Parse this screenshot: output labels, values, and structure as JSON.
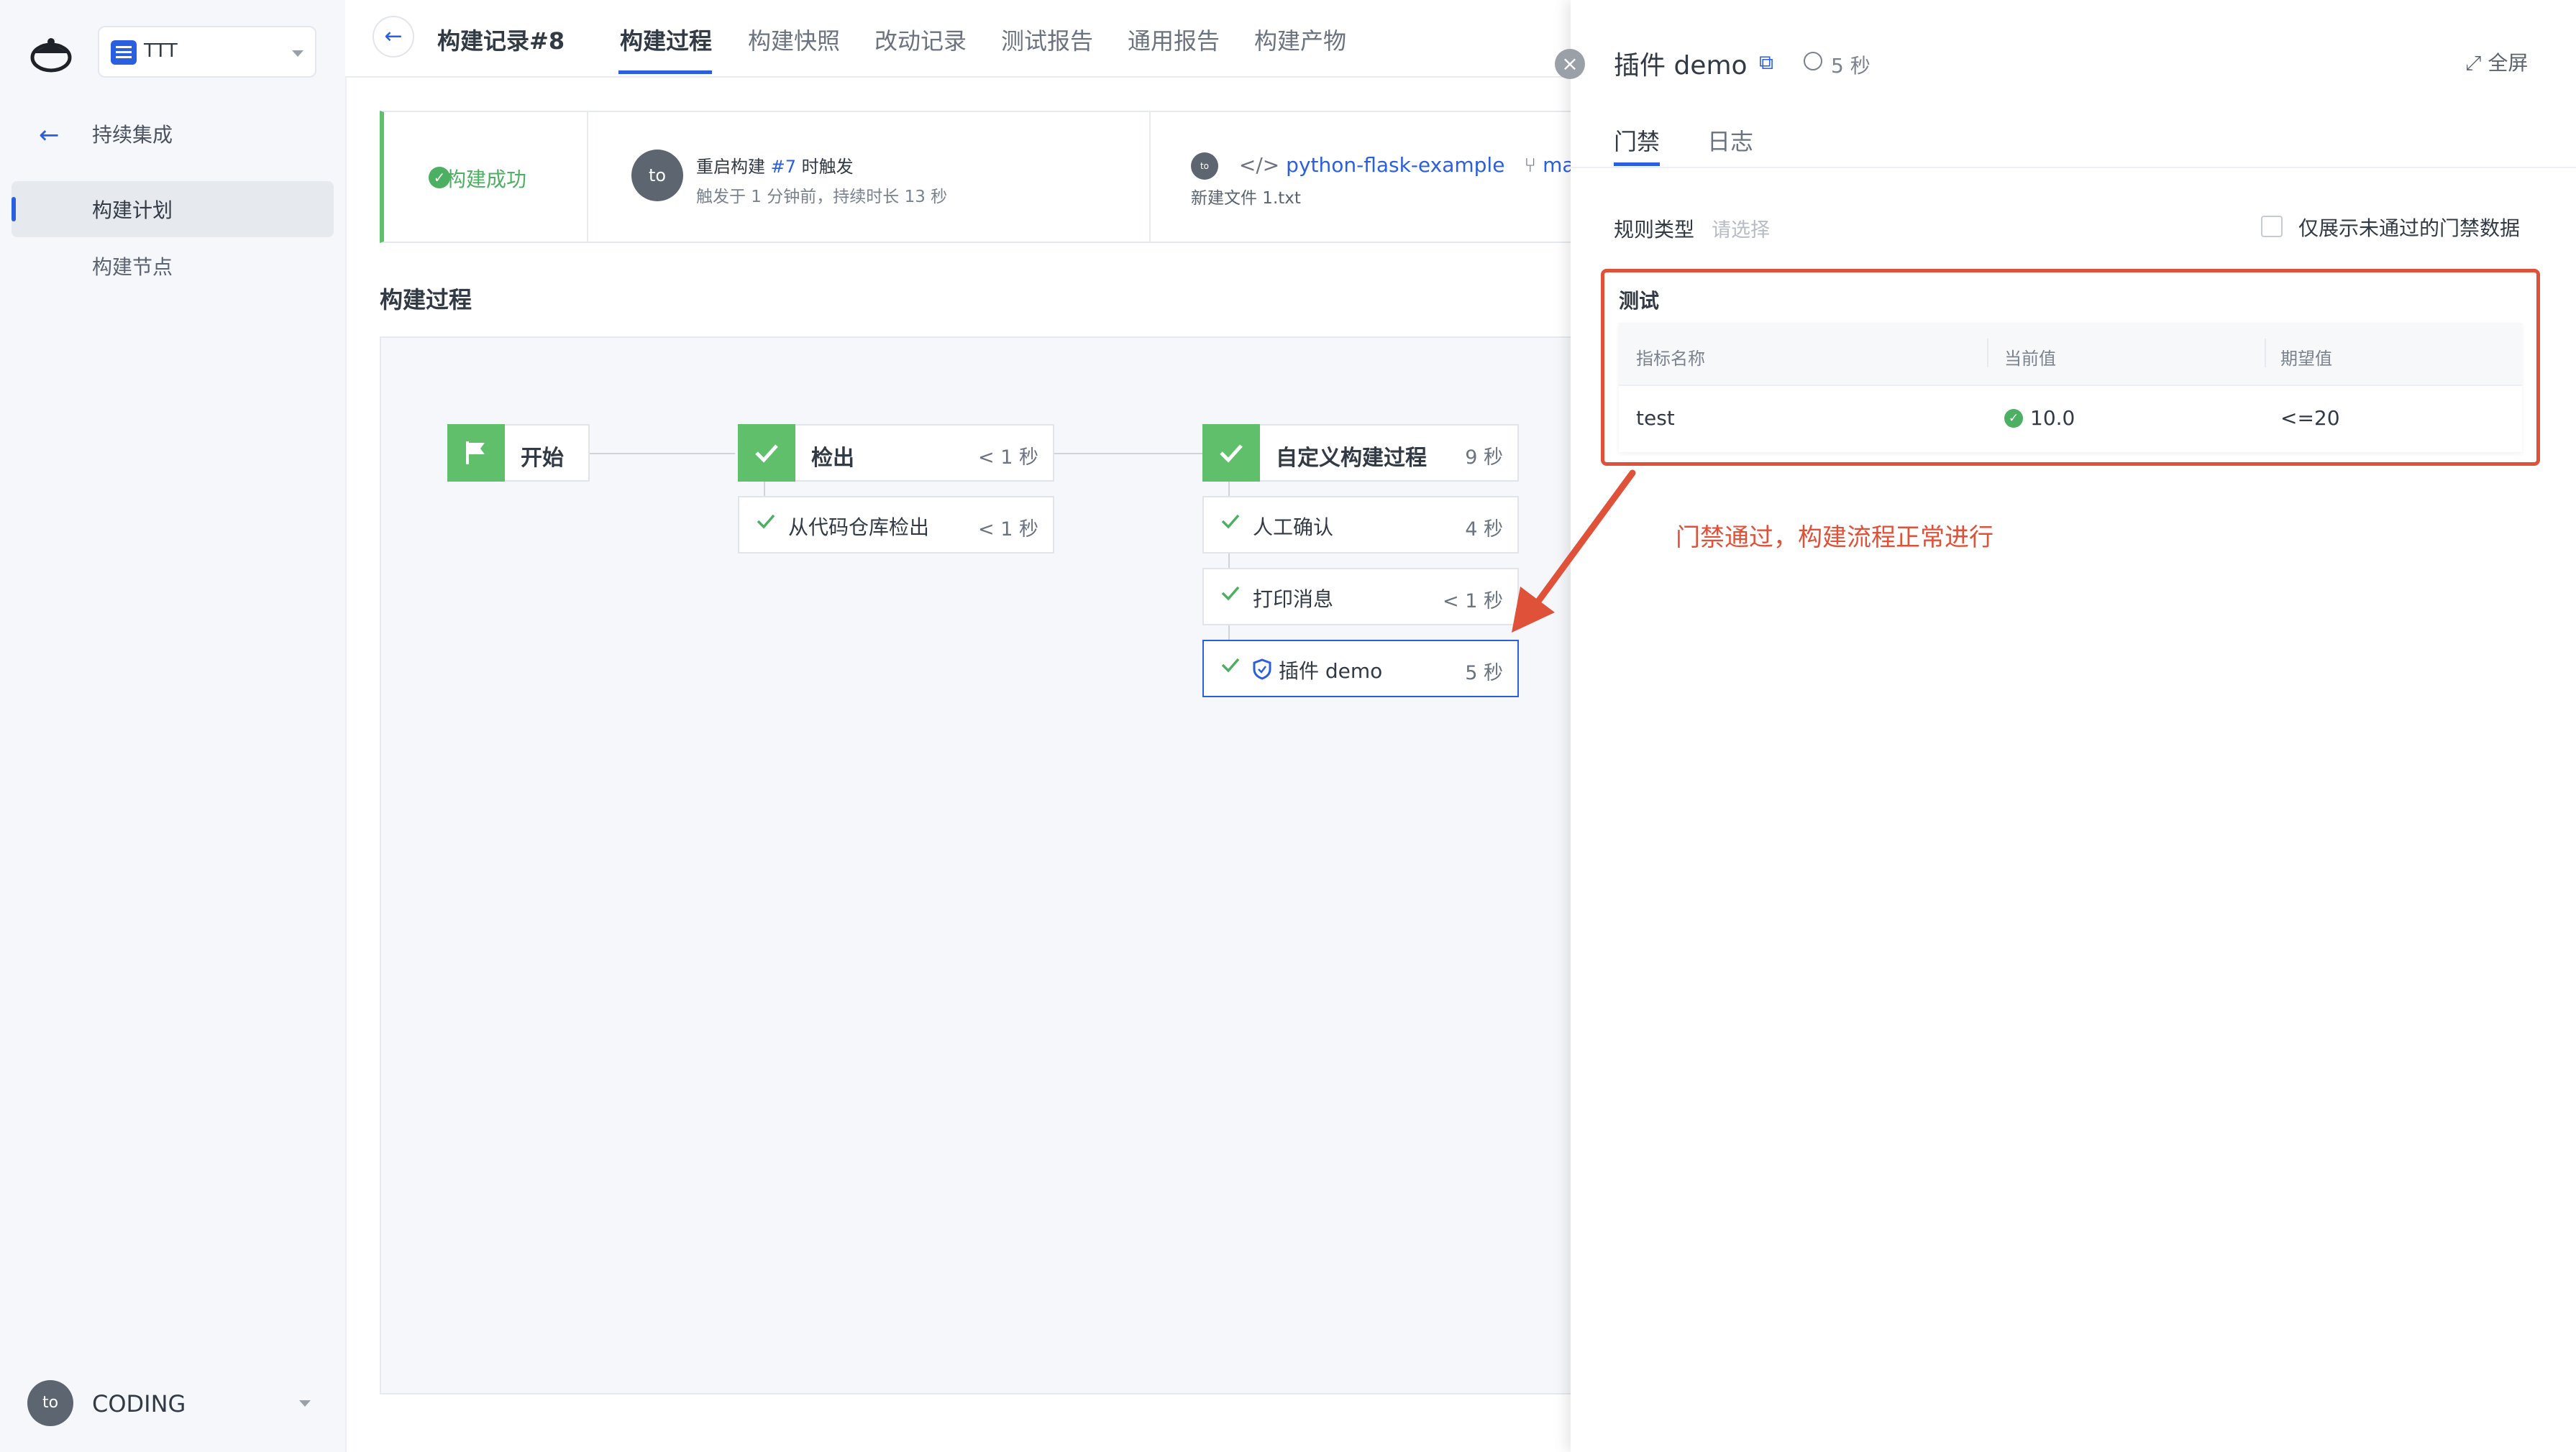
{
  "sidebar": {
    "project_name": "TTT",
    "back_label": "持续集成",
    "items": [
      {
        "label": "构建计划",
        "active": true
      },
      {
        "label": "构建节点",
        "active": false
      }
    ],
    "user": {
      "avatar_text": "to",
      "name": "CODING"
    }
  },
  "header": {
    "record_title": "构建记录#8",
    "tabs": [
      {
        "label": "构建过程",
        "active": true
      },
      {
        "label": "构建快照"
      },
      {
        "label": "改动记录"
      },
      {
        "label": "测试报告"
      },
      {
        "label": "通用报告"
      },
      {
        "label": "构建产物"
      }
    ]
  },
  "summary": {
    "status_label": "构建成功",
    "avatar_text": "to",
    "trigger_prefix": "重启构建",
    "trigger_ref": "#7",
    "trigger_suffix": "时触发",
    "trigger_detail": "触发于 1 分钟前，持续时长 13 秒",
    "repo_avatar_text": "to",
    "repo_name": "python-flask-example",
    "branch": "master",
    "commit_message": "新建文件 1.txt"
  },
  "process": {
    "title": "构建过程",
    "stages": [
      {
        "name": "开始",
        "duration": "",
        "steps": []
      },
      {
        "name": "检出",
        "duration": "< 1 秒",
        "steps": [
          {
            "name": "从代码仓库检出",
            "duration": "< 1 秒"
          }
        ]
      },
      {
        "name": "自定义构建过程",
        "duration": "9 秒",
        "steps": [
          {
            "name": "人工确认",
            "duration": "4 秒"
          },
          {
            "name": "打印消息",
            "duration": "< 1 秒"
          },
          {
            "name": "插件 demo",
            "duration": "5 秒",
            "selected": true
          }
        ]
      }
    ]
  },
  "drawer": {
    "title": "插件 demo",
    "duration": "5 秒",
    "fullscreen_label": "全屏",
    "tabs": [
      {
        "label": "门禁",
        "active": true
      },
      {
        "label": "日志"
      }
    ],
    "filter": {
      "rule_type_label": "规则类型",
      "rule_type_placeholder": "请选择",
      "only_failed_label": "仅展示未通过的门禁数据",
      "only_failed_checked": false
    },
    "gate": {
      "group": "测试",
      "columns": [
        "指标名称",
        "当前值",
        "期望值"
      ],
      "rows": [
        {
          "metric": "test",
          "current": "10.0",
          "expected": "<=20",
          "passed": true
        }
      ]
    }
  },
  "annotation": {
    "text": "门禁通过，构建流程正常进行",
    "color": "#e0513a"
  },
  "colors": {
    "accent": "#2a5fe0",
    "success": "#5fbf6a",
    "annotation": "#e0513a"
  }
}
